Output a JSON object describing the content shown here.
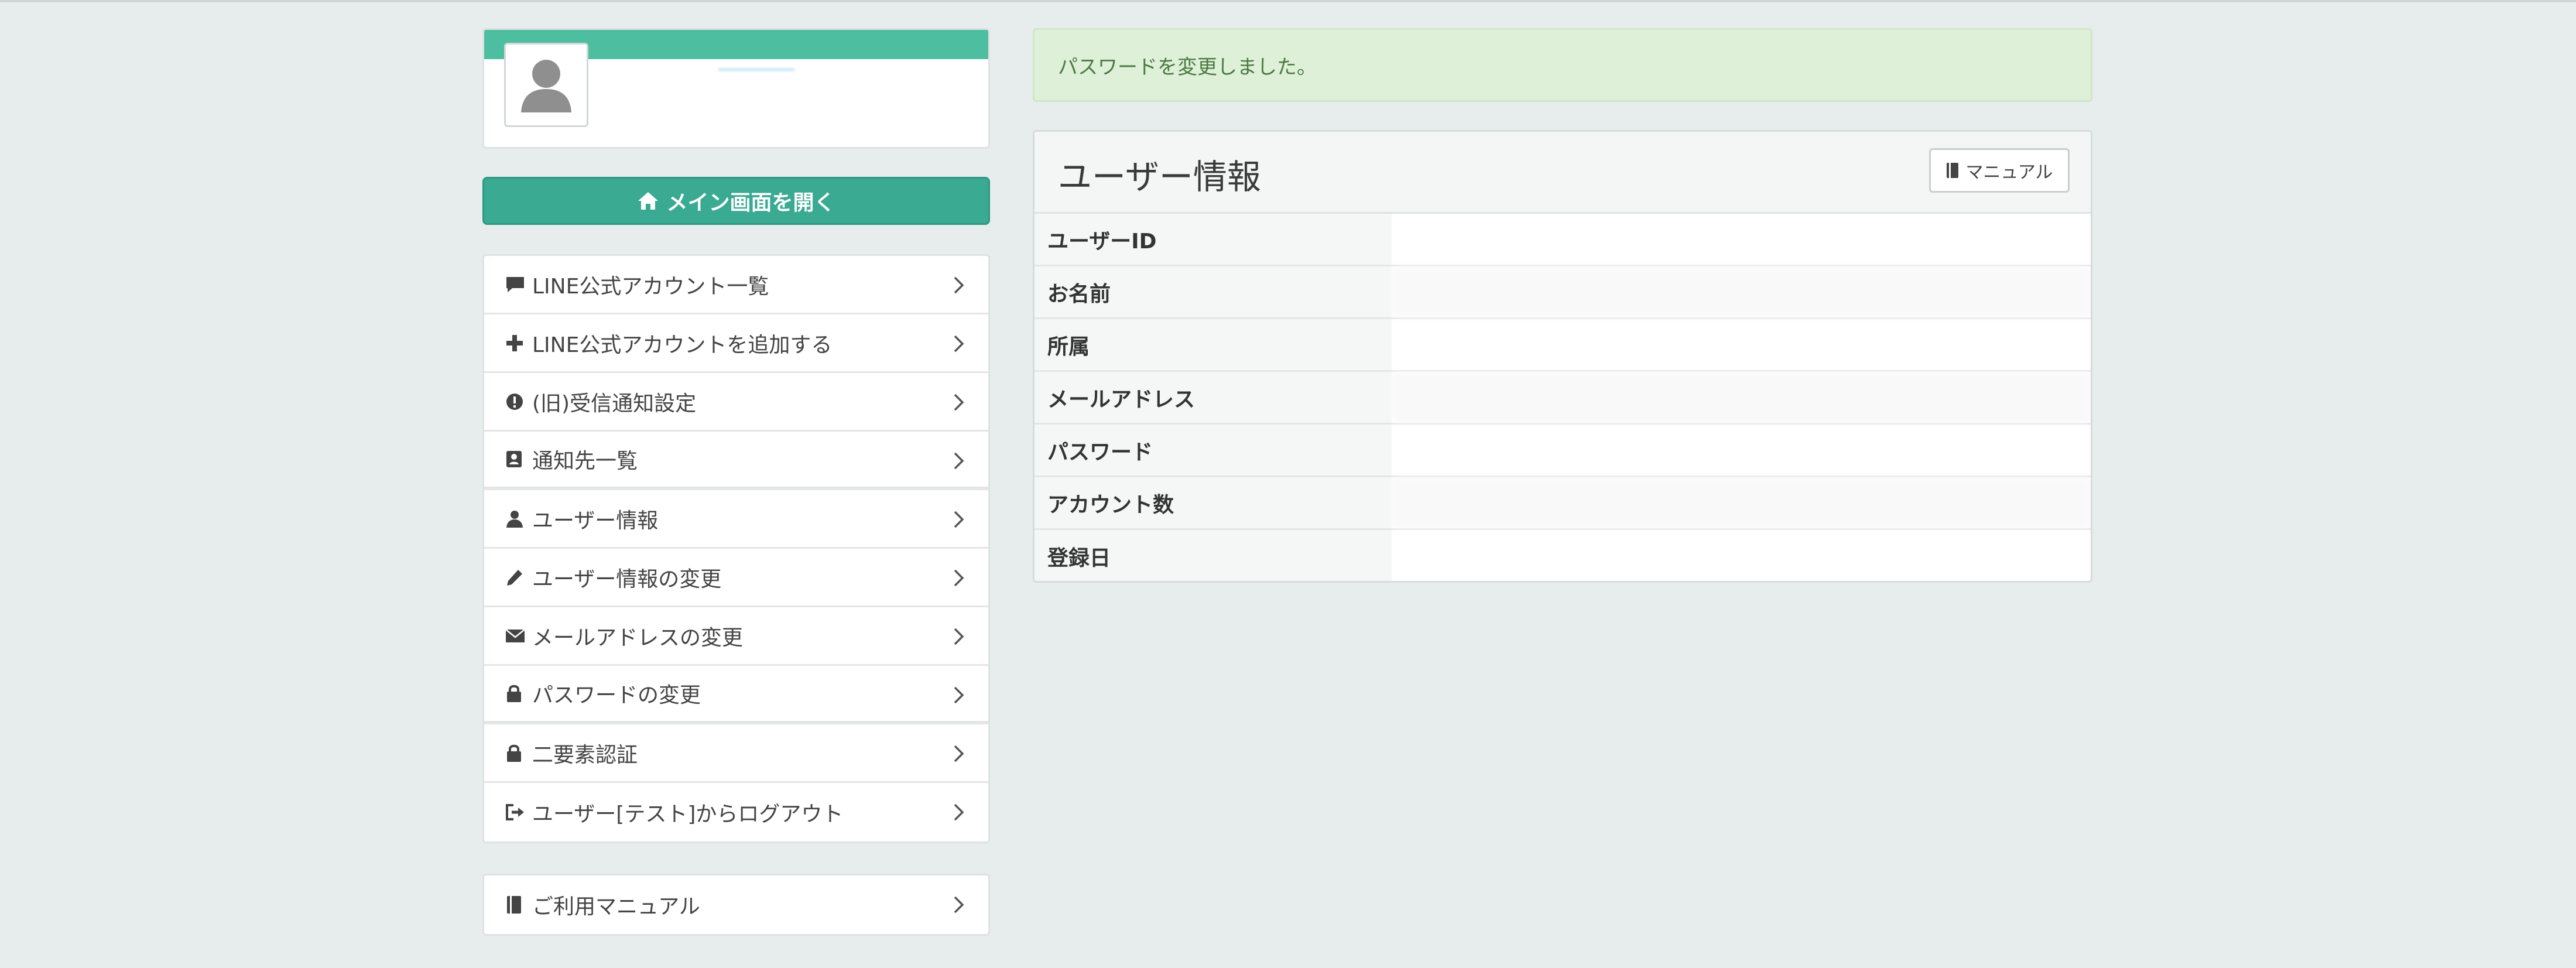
{
  "colors": {
    "accent": "#3aaa92",
    "profile_band": "#4dbea0",
    "alert_bg": "#dff0d8",
    "alert_text": "#4a7a42",
    "page_bg": "#e6edec"
  },
  "profile": {
    "name": "",
    "sub": "",
    "avatar_icon": "user-silhouette-icon"
  },
  "main_button": {
    "label": "メイン画面を開く",
    "icon": "home-icon"
  },
  "menu": {
    "items": [
      {
        "label": "LINE公式アカウント一覧",
        "icon": "comment-icon"
      },
      {
        "label": "LINE公式アカウントを追加する",
        "icon": "plus-icon"
      },
      {
        "label": "(旧)受信通知設定",
        "icon": "exclamation-circle-icon"
      },
      {
        "label": "通知先一覧",
        "icon": "contact-book-icon"
      },
      {
        "label": "ユーザー情報",
        "icon": "user-icon"
      },
      {
        "label": "ユーザー情報の変更",
        "icon": "pencil-icon"
      },
      {
        "label": "メールアドレスの変更",
        "icon": "envelope-icon"
      },
      {
        "label": "パスワードの変更",
        "icon": "lock-icon"
      },
      {
        "label": "二要素認証",
        "icon": "lock-icon"
      },
      {
        "label": "ユーザー[テスト]からログアウト",
        "icon": "logout-icon"
      }
    ]
  },
  "manual_menu": {
    "label": "ご利用マニュアル",
    "icon": "book-icon"
  },
  "alert": {
    "message": "パスワードを変更しました。"
  },
  "panel": {
    "title": "ユーザー情報",
    "manual_button": "マニュアル",
    "rows": [
      {
        "label": "ユーザーID",
        "value": ""
      },
      {
        "label": "お名前",
        "value": ""
      },
      {
        "label": "所属",
        "value": ""
      },
      {
        "label": "メールアドレス",
        "value": ""
      },
      {
        "label": "パスワード",
        "value": ""
      },
      {
        "label": "アカウント数",
        "value": ""
      },
      {
        "label": "登録日",
        "value": ""
      }
    ]
  }
}
